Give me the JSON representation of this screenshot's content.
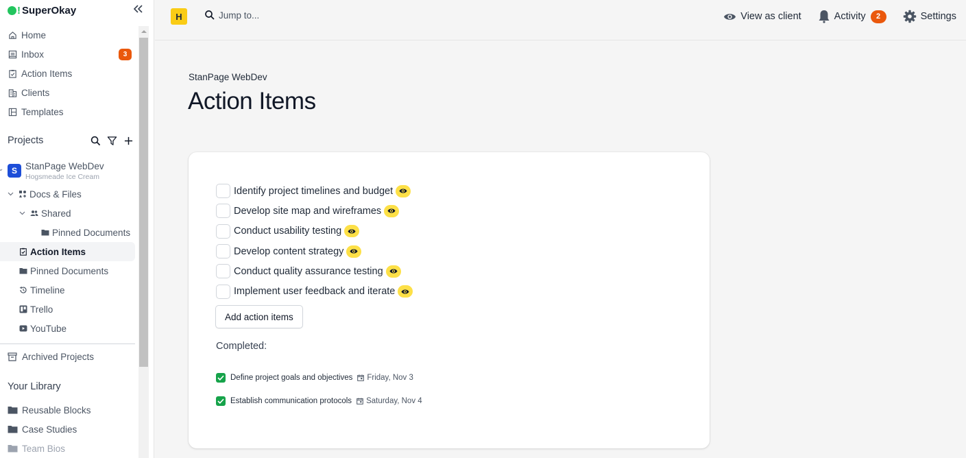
{
  "app": {
    "name": "SuperOkay",
    "brand_color": "#22c55e",
    "collapse_icon": "double-chevron-left-icon"
  },
  "sidebar": {
    "nav": [
      {
        "label": "Home",
        "icon": "home-icon"
      },
      {
        "label": "Inbox",
        "icon": "inbox-icon",
        "badge": "3"
      },
      {
        "label": "Action Items",
        "icon": "clipboard-check-icon"
      },
      {
        "label": "Clients",
        "icon": "building-icon"
      },
      {
        "label": "Templates",
        "icon": "layout-icon"
      }
    ],
    "projects_header": "Projects",
    "project": {
      "avatar_letter": "S",
      "name": "StanPage WebDev",
      "client": "Hogsmeade Ice Cream"
    },
    "tree": [
      {
        "label": "Docs & Files",
        "icon": "docs-icon"
      },
      {
        "label": "Shared",
        "icon": "users-icon"
      },
      {
        "label": "Pinned Documents",
        "icon": "folder-icon"
      },
      {
        "label": "Action Items",
        "icon": "clipboard-check-icon",
        "active": true
      },
      {
        "label": "Pinned Documents",
        "icon": "folder-icon"
      },
      {
        "label": "Timeline",
        "icon": "history-icon"
      },
      {
        "label": "Trello",
        "icon": "trello-icon"
      },
      {
        "label": "YouTube",
        "icon": "youtube-icon"
      }
    ],
    "archived": "Archived Projects",
    "library_header": "Your Library",
    "library": [
      {
        "label": "Reusable Blocks"
      },
      {
        "label": "Case Studies"
      },
      {
        "label": "Team Bios"
      }
    ]
  },
  "topbar": {
    "workspace_letter": "H",
    "jump_placeholder": "Jump to...",
    "view_as_client": "View as client",
    "activity": "Activity",
    "activity_badge": "2",
    "settings": "Settings"
  },
  "main": {
    "breadcrumb": "StanPage WebDev",
    "title": "Action Items",
    "todos": [
      {
        "text": "Identify project timelines and budget",
        "visible_to_client": true
      },
      {
        "text": "Develop site map and wireframes",
        "visible_to_client": true
      },
      {
        "text": "Conduct usability testing",
        "visible_to_client": true
      },
      {
        "text": "Develop content strategy",
        "visible_to_client": true
      },
      {
        "text": "Conduct quality assurance testing",
        "visible_to_client": true
      },
      {
        "text": "Implement user feedback and iterate",
        "visible_to_client": true
      }
    ],
    "add_button": "Add action items",
    "completed_label": "Completed:",
    "completed": [
      {
        "text": "Define project goals and objectives",
        "date": "Friday, Nov 3"
      },
      {
        "text": "Establish communication protocols",
        "date": "Saturday, Nov 4"
      }
    ],
    "colors": {
      "badge": "#ea580c",
      "eye_badge": "#fde047",
      "done_check": "#16a34a",
      "project_avatar": "#1d4ed8",
      "workspace_avatar": "#facc15"
    }
  }
}
